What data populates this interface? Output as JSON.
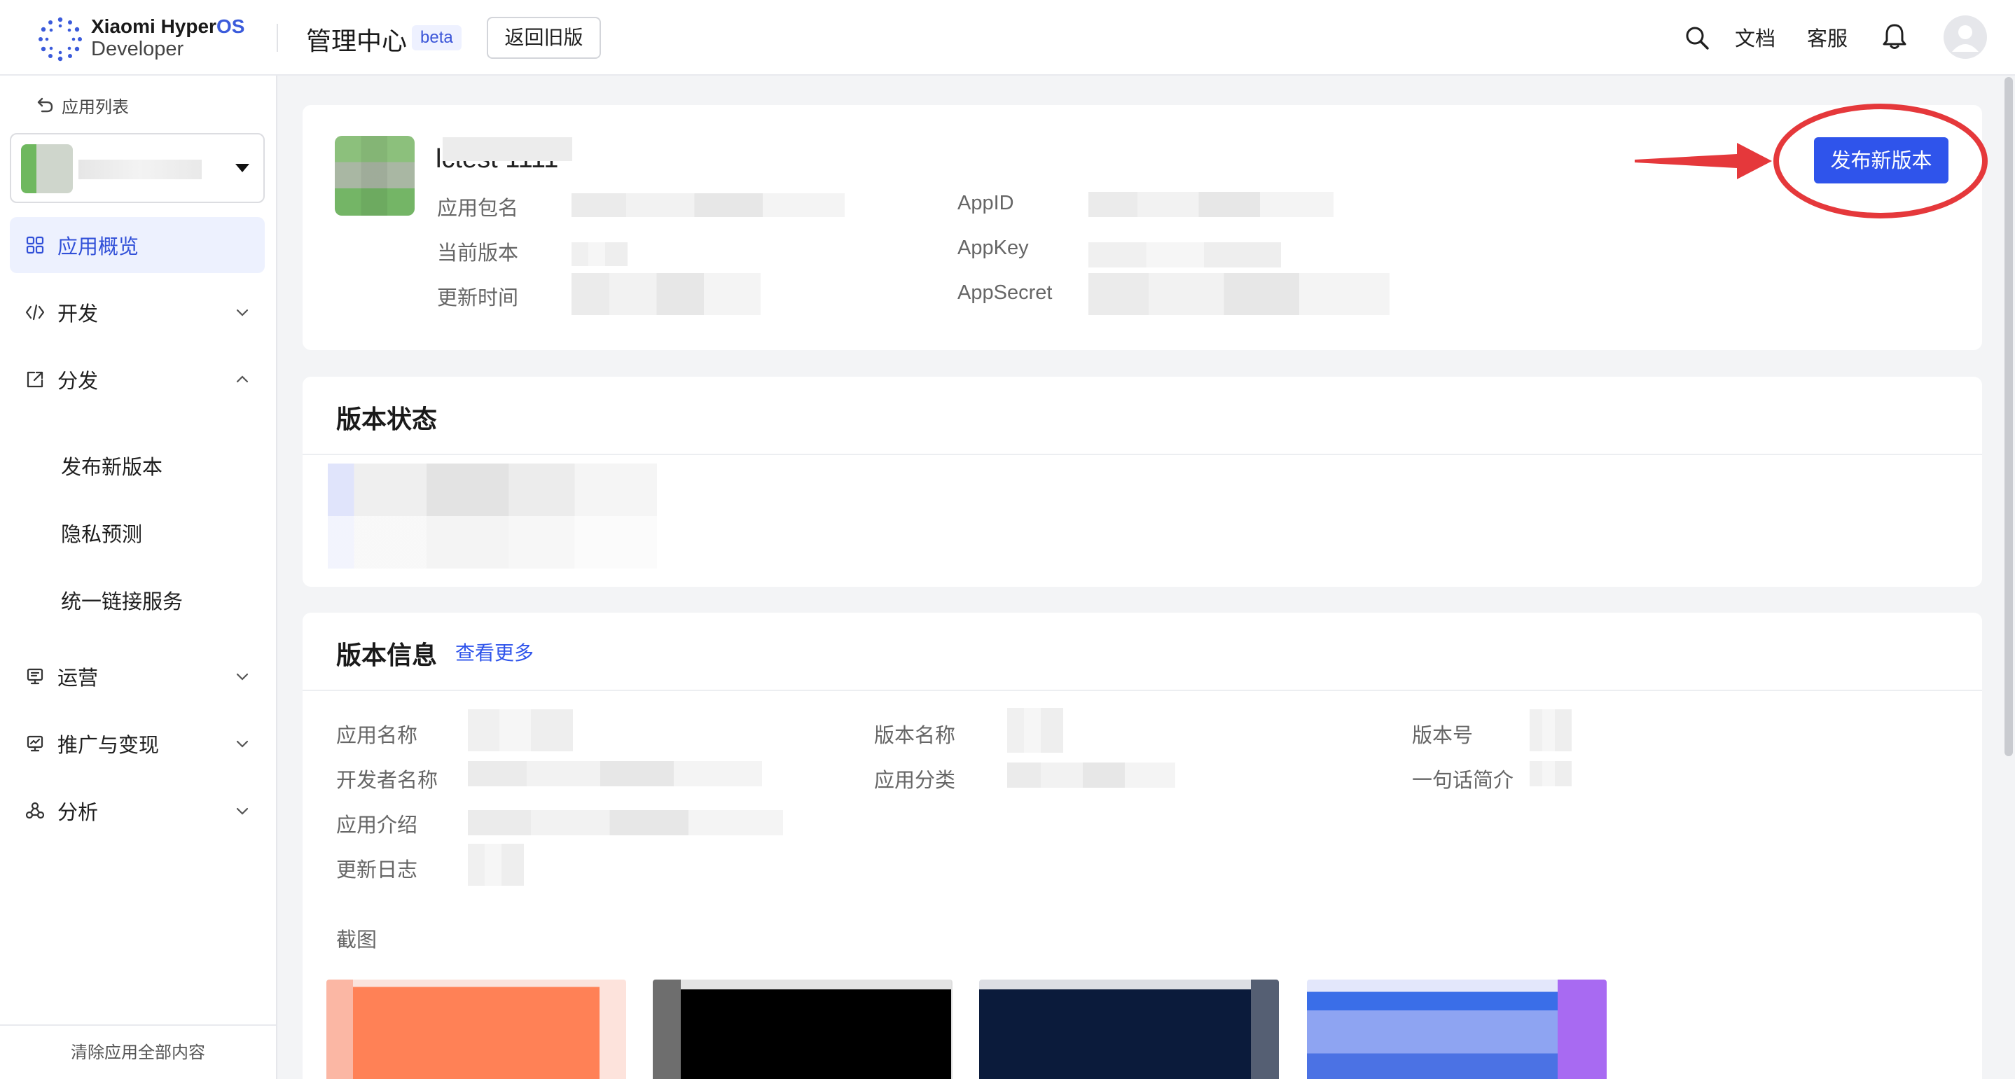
{
  "header": {
    "brand_line1": "Xiaomi Hyper",
    "brand_line1_accent": "OS",
    "brand_line2": "Developer",
    "title": "管理中心",
    "beta": "beta",
    "back_old_label": "返回旧版",
    "docs": "文档",
    "service": "客服",
    "icons": [
      "search-icon",
      "bell-icon",
      "user-avatar-icon"
    ]
  },
  "sidebar": {
    "back_label": "应用列表",
    "items": [
      {
        "label": "应用概览",
        "icon": "grid-icon",
        "active": true
      },
      {
        "label": "开发",
        "icon": "code-icon",
        "expanded": false
      },
      {
        "label": "分发",
        "icon": "share-icon",
        "expanded": true
      },
      {
        "label": "运营",
        "icon": "monitor-icon",
        "expanded": false
      },
      {
        "label": "推广与变现",
        "icon": "chart-icon",
        "expanded": false
      },
      {
        "label": "分析",
        "icon": "cluster-icon",
        "expanded": false
      }
    ],
    "sub_items": [
      "发布新版本",
      "隐私预测",
      "统一链接服务"
    ],
    "footer": "清除应用全部内容"
  },
  "app_card": {
    "app_name": "lctest 1111",
    "labels": {
      "package": "应用包名",
      "current_version": "当前版本",
      "update_time": "更新时间",
      "appid": "AppID",
      "appkey": "AppKey",
      "appsecret": "AppSecret"
    },
    "publish_label": "发布新版本",
    "annotation_color": "#e5383b"
  },
  "version_status": {
    "title": "版本状态"
  },
  "version_info": {
    "title": "版本信息",
    "more_link": "查看更多",
    "labels": {
      "app_name": "应用名称",
      "developer_name": "开发者名称",
      "app_intro": "应用介绍",
      "changelog": "更新日志",
      "version_name": "版本名称",
      "app_category": "应用分类",
      "version_code": "版本号",
      "one_line_intro": "一句话简介",
      "screenshots": "截图"
    }
  },
  "colors": {
    "primary": "#2f54eb",
    "active_bg": "#edf1fe",
    "page_bg": "#f3f4f6"
  }
}
